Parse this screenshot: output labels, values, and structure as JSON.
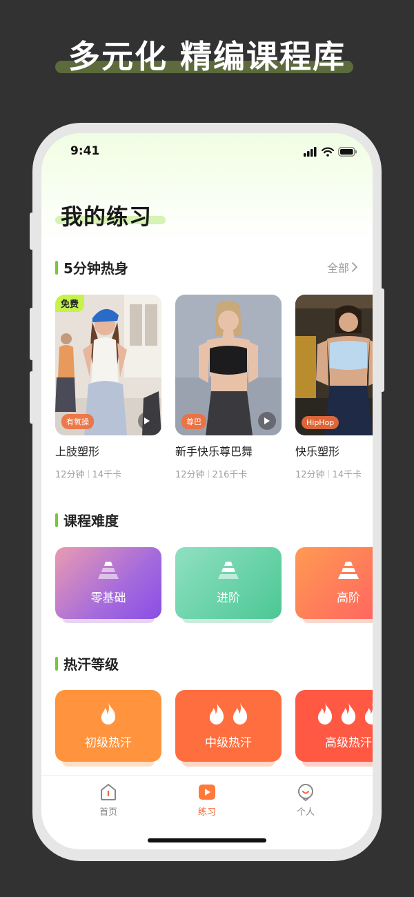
{
  "promo": {
    "title": "多元化 精编课程库"
  },
  "status_bar": {
    "time": "9:41"
  },
  "page": {
    "title": "我的练习"
  },
  "warmup": {
    "title": "5分钟热身",
    "see_all": "全部",
    "cards": [
      {
        "title": "上肢塑形",
        "duration": "12分钟",
        "calories": "14千卡",
        "tag": "有氧操",
        "free_badge": "免费"
      },
      {
        "title": "新手快乐尊巴舞",
        "duration": "12分钟",
        "calories": "216千卡",
        "tag": "尊巴"
      },
      {
        "title": "快乐塑形",
        "duration": "12分钟",
        "calories": "14千卡",
        "tag": "HipHop"
      }
    ]
  },
  "difficulty": {
    "title": "课程难度",
    "items": [
      {
        "label": "零基础"
      },
      {
        "label": "进阶"
      },
      {
        "label": "高阶"
      }
    ]
  },
  "sweat": {
    "title": "热汗等级",
    "items": [
      {
        "label": "初级热汗"
      },
      {
        "label": "中级热汗"
      },
      {
        "label": "高级热汗"
      }
    ]
  },
  "tabbar": {
    "tabs": [
      {
        "label": "首页",
        "icon": "home-icon"
      },
      {
        "label": "练习",
        "icon": "play-icon",
        "active": true
      },
      {
        "label": "个人",
        "icon": "profile-icon"
      }
    ]
  },
  "colors": {
    "accent_green": "#76c93a",
    "accent_orange": "#f06a3a",
    "free_badge": "#c6f24a"
  }
}
